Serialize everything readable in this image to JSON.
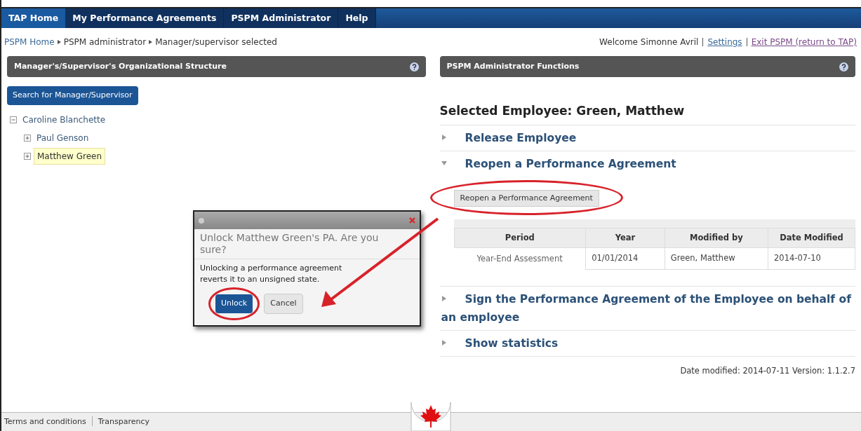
{
  "nav": [
    {
      "label": "TAP Home",
      "selected": true
    },
    {
      "label": "My Performance Agreements",
      "selected": false
    },
    {
      "label": "PSPM Administrator",
      "selected": false
    },
    {
      "label": "Help",
      "selected": false
    }
  ],
  "breadcrumb": [
    {
      "label": "PSPM Home",
      "kind": "link"
    },
    {
      "label": "PSPM administrator",
      "kind": "text"
    },
    {
      "label": "Manager/supervisor selected",
      "kind": "text"
    }
  ],
  "user_bar": {
    "welcome": "Welcome Simonne Avril",
    "links": [
      "Settings",
      "Exit PSPM (return to TAP)"
    ]
  },
  "left_panel": {
    "title": "Manager's/Supervisor's Organizational Structure",
    "search_button": "Search for Manager/Supervisor",
    "tree": [
      {
        "label": "Caroline Blanchette",
        "expanded": true,
        "selected": false,
        "children": [
          {
            "label": "Paul Genson",
            "expanded": false,
            "selected": false
          },
          {
            "label": "Matthew Green",
            "expanded": false,
            "selected": true
          }
        ]
      }
    ]
  },
  "right_panel": {
    "title": "PSPM Administrator Functions",
    "heading": "Selected Employee: Green, Matthew",
    "sections": [
      {
        "label": "Release Employee",
        "expanded": false
      },
      {
        "label": "Reopen a Performance Agreement",
        "expanded": true,
        "button": "Reopen a Performance Agreement",
        "table": {
          "columns": [
            "Period",
            "Year",
            "Modified by",
            "Date Modified"
          ],
          "rows": [
            [
              "Year-End Assessment",
              "01/01/2014",
              "Green, Matthew",
              "2014-07-10"
            ]
          ]
        }
      },
      {
        "label": "Sign the Performance Agreement of the Employee on behalf of an employee",
        "expanded": false
      },
      {
        "label": "Show statistics",
        "expanded": false
      }
    ],
    "footer_note": "Date modified: 2014-07-11 Version: 1.1.2.7"
  },
  "dialog": {
    "title": "Unlock Matthew Green's PA. Are you sure?",
    "message": "Unlocking a performance agreement reverts it to an unsigned state.",
    "buttons": [
      {
        "label": "Unlock",
        "kind": "primary"
      },
      {
        "label": "Cancel",
        "kind": "secondary"
      }
    ]
  },
  "footer": {
    "links": [
      "Terms and conditions",
      "Transparency"
    ]
  }
}
